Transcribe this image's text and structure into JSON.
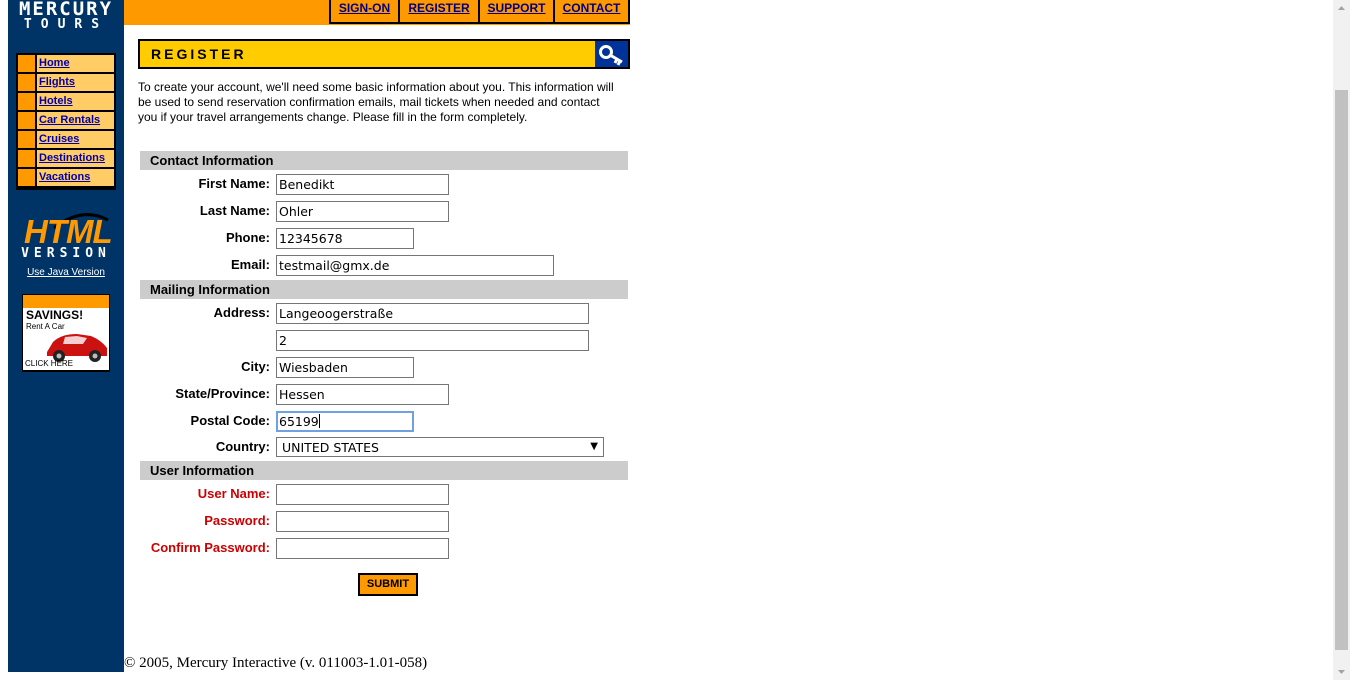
{
  "brand": {
    "line1": "MERCURY",
    "line2": "TOURS"
  },
  "top_nav": [
    {
      "label": "SIGN-ON"
    },
    {
      "label": "REGISTER"
    },
    {
      "label": "SUPPORT"
    },
    {
      "label": "CONTACT"
    }
  ],
  "side_nav": [
    {
      "label": "Home"
    },
    {
      "label": "Flights"
    },
    {
      "label": "Hotels"
    },
    {
      "label": "Car Rentals"
    },
    {
      "label": "Cruises"
    },
    {
      "label": "Destinations"
    },
    {
      "label": "Vacations"
    }
  ],
  "html_version": {
    "big": "HTML",
    "sub": "VERSION",
    "java_link": "Use Java Version"
  },
  "ad": {
    "title": "SAVINGS!",
    "subtitle": "Rent A Car",
    "cta": "CLICK HERE"
  },
  "banner": {
    "title": "REGISTER",
    "icon": "key-icon"
  },
  "intro": "To create your account, we'll need some basic information about you. This information will be used to send reservation confirmation emails, mail tickets when needed and contact you if your travel arrangements change. Please fill in the form completely.",
  "contact": {
    "section_title": "Contact Information",
    "first_name_label": "First Name:",
    "first_name_value": "Benedikt",
    "last_name_label": "Last Name:",
    "last_name_value": "Ohler",
    "phone_label": "Phone:",
    "phone_value": "12345678",
    "email_label": "Email:",
    "email_value": "testmail@gmx.de"
  },
  "mailing": {
    "section_title": "Mailing Information",
    "address_label": "Address:",
    "address1_value": "Langeoogerstraße",
    "address2_value": "2",
    "city_label": "City:",
    "city_value": "Wiesbaden",
    "state_label": "State/Province:",
    "state_value": "Hessen",
    "postal_label": "Postal Code:",
    "postal_value": "65199",
    "country_label": "Country:",
    "country_value": "UNITED STATES"
  },
  "user": {
    "section_title": "User Information",
    "username_label": "User Name:",
    "username_value": "",
    "password_label": "Password:",
    "password_value": "",
    "confirm_label": "Confirm Password:",
    "confirm_value": ""
  },
  "submit_label": "SUBMIT",
  "footer": "© 2005, Mercury Interactive (v. 011003-1.01-058)",
  "colors": {
    "sidebar": "#003366",
    "orange": "#ff9900",
    "light_orange": "#ffcc66",
    "banner_yellow": "#ffcc00",
    "required_red": "#cc0000",
    "section_gray": "#cccccc"
  }
}
